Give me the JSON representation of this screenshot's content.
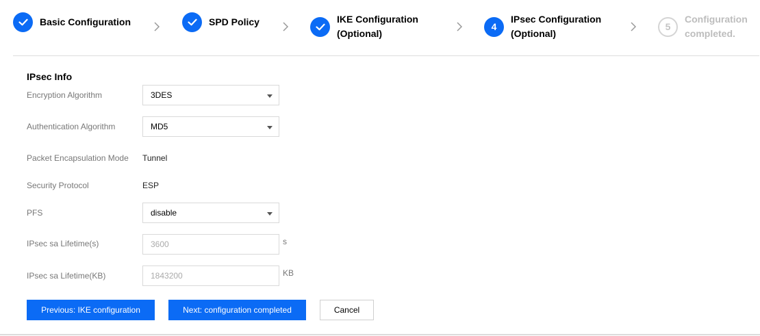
{
  "stepper": {
    "steps": [
      {
        "status": "done",
        "label_line1": "Basic Configuration",
        "label_line2": ""
      },
      {
        "status": "done",
        "label_line1": "SPD Policy",
        "label_line2": ""
      },
      {
        "status": "done",
        "label_line1": "IKE Configuration",
        "label_line2": "(Optional)"
      },
      {
        "status": "active",
        "number": "4",
        "label_line1": "IPsec Configuration",
        "label_line2": "(Optional)"
      },
      {
        "status": "pending",
        "number": "5",
        "label_line1": "Configuration",
        "label_line2": "completed."
      }
    ],
    "colors": {
      "accent": "#0b6bf5",
      "pending_border": "#d4d4d4",
      "pending_text": "#bdbdbd"
    }
  },
  "form": {
    "section_title": "IPsec Info",
    "encryption_algorithm": {
      "label": "Encryption Algorithm",
      "value": "3DES"
    },
    "authentication_algorithm": {
      "label": "Authentication Algorithm",
      "value": "MD5"
    },
    "packet_encapsulation_mode": {
      "label": "Packet Encapsulation Mode",
      "value": "Tunnel"
    },
    "security_protocol": {
      "label": "Security Protocol",
      "value": "ESP"
    },
    "pfs": {
      "label": "PFS",
      "value": "disable"
    },
    "lifetime_s": {
      "label": "IPsec sa Lifetime(s)",
      "placeholder": "3600",
      "unit": "s"
    },
    "lifetime_kb": {
      "label": "IPsec sa Lifetime(KB)",
      "placeholder": "1843200",
      "unit": "KB"
    }
  },
  "actions": {
    "previous_label": "Previous: IKE configuration",
    "next_label": "Next: configuration completed",
    "cancel_label": "Cancel"
  }
}
